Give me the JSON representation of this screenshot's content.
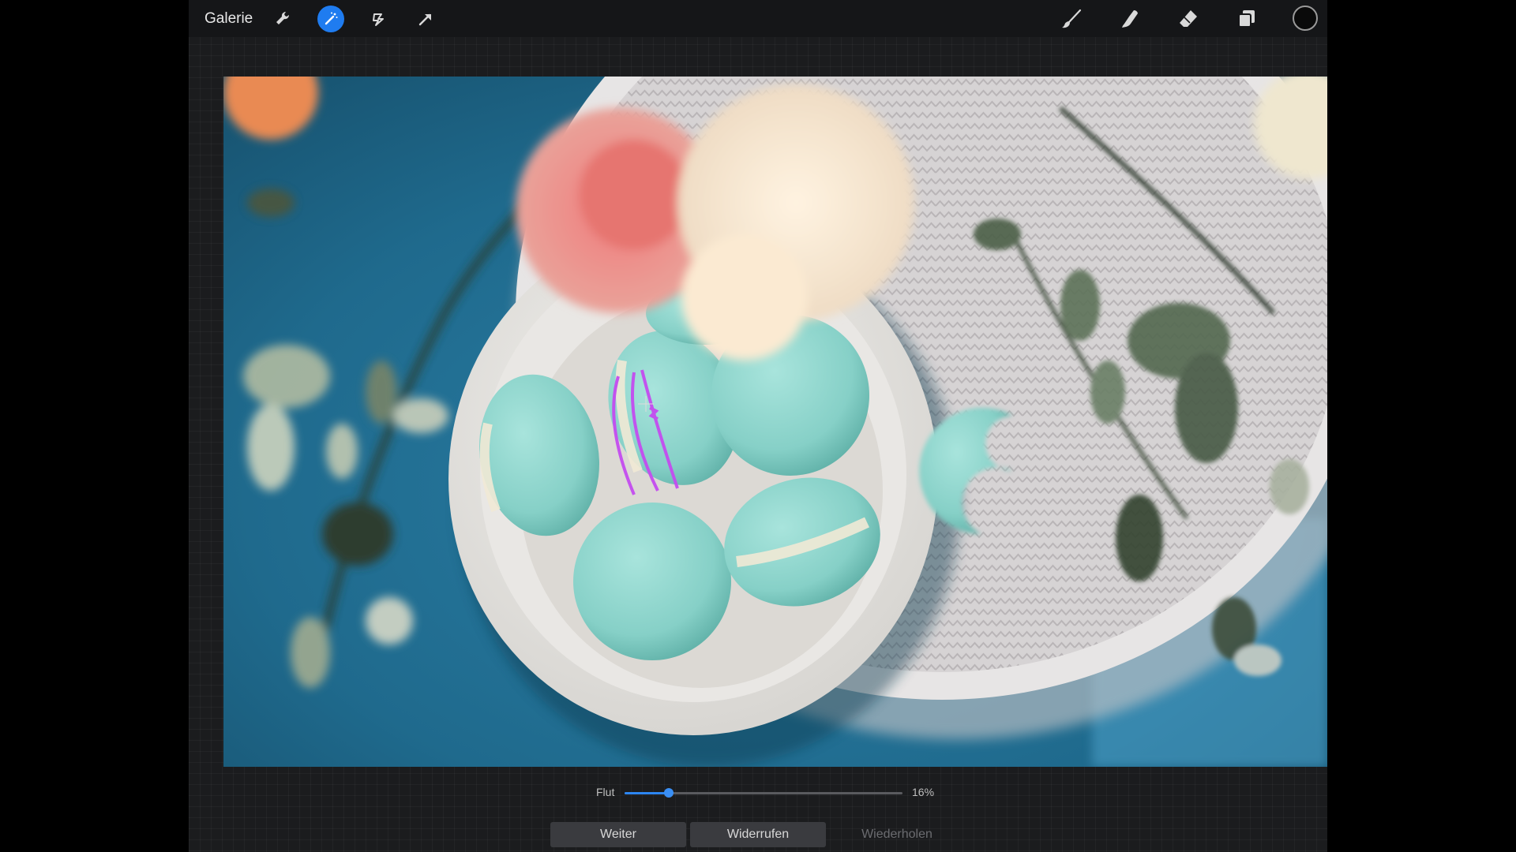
{
  "toolbar": {
    "gallery_label": "Galerie",
    "left_tools": [
      "wrench-icon",
      "magic-wand-icon",
      "selection-icon",
      "transform-arrow-icon"
    ],
    "right_tools": [
      "brush-icon",
      "smudge-icon",
      "eraser-icon",
      "layers-icon"
    ],
    "active_tool": "magic-wand-icon",
    "current_color": "#0a0a0a"
  },
  "canvas": {
    "content": "photo"
  },
  "flood_slider": {
    "label": "Flut",
    "value": 0.16,
    "value_text": "16%"
  },
  "actions": {
    "next_label": "Weiter",
    "undo_label": "Widerrufen",
    "redo_label": "Wiederholen"
  },
  "colors": {
    "accent": "#1f7cf0",
    "toolbar_bg": "#151618",
    "workspace_bg": "#1b1c1e",
    "selection_highlight": "#c44cf0"
  }
}
